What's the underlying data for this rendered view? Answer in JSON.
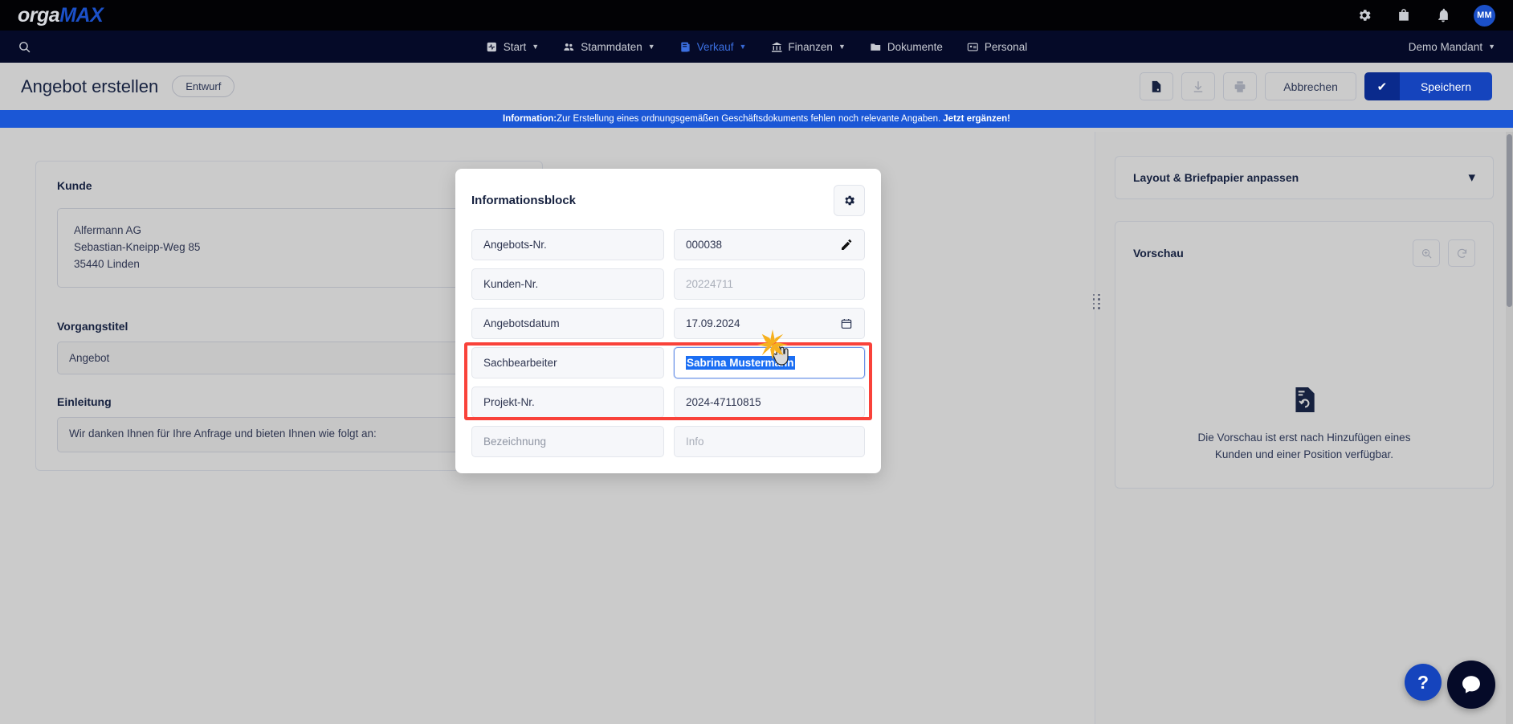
{
  "app": {
    "logo_orga": "orga",
    "logo_max": "MAX"
  },
  "topbar": {
    "icons": [
      "gear-icon",
      "shopping-bag-icon",
      "bell-icon"
    ],
    "avatar_initials": "MM"
  },
  "nav": {
    "search_icon": "search-icon",
    "items": [
      {
        "label": "Start",
        "icon": "activity-icon",
        "has_caret": true,
        "active": false
      },
      {
        "label": "Stammdaten",
        "icon": "people-icon",
        "has_caret": true,
        "active": false
      },
      {
        "label": "Verkauf",
        "icon": "document-icon",
        "has_caret": true,
        "active": true
      },
      {
        "label": "Finanzen",
        "icon": "bank-icon",
        "has_caret": true,
        "active": false
      },
      {
        "label": "Dokumente",
        "icon": "folder-icon",
        "has_caret": false,
        "active": false
      },
      {
        "label": "Personal",
        "icon": "id-card-icon",
        "has_caret": false,
        "active": false
      }
    ],
    "tenant": "Demo Mandant"
  },
  "header": {
    "title": "Angebot erstellen",
    "status_badge": "Entwurf",
    "actions": {
      "preview_doc_icon": "document-preview-icon",
      "download_icon": "download-icon",
      "print_icon": "print-icon",
      "cancel_label": "Abbrechen",
      "save_label": "Speichern",
      "save_check": "✔"
    }
  },
  "banner": {
    "prefix": "Information:",
    "message": " Zur Erstellung eines ordnungsgemäßen Geschäftsdokuments fehlen noch relevante Angaben.",
    "link": "Jetzt ergänzen!"
  },
  "left": {
    "kunde_label": "Kunde",
    "kunde_address": [
      "Alfermann AG",
      "Sebastian-Kneipp-Weg 85",
      "35440 Linden"
    ],
    "vorgangstitel_label": "Vorgangstitel",
    "vorgangstitel_value": "Angebot",
    "einleitung_label": "Einleitung",
    "einleitung_value": "Wir danken Ihnen für Ihre Anfrage und bieten Ihnen wie folgt an:",
    "einleitung_gear_icon": "gear-icon"
  },
  "info_card": {
    "title": "Informationsblock",
    "gear_icon": "gear-icon",
    "rows": [
      {
        "key": "Angebots-Nr.",
        "value": "000038",
        "muted_key": false,
        "muted_value": false,
        "trailing": "pencil-icon",
        "focused": false
      },
      {
        "key": "Kunden-Nr.",
        "value": "20224711",
        "muted_key": false,
        "muted_value": true,
        "trailing": "",
        "focused": false
      },
      {
        "key": "Angebotsdatum",
        "value": "17.09.2024",
        "muted_key": false,
        "muted_value": false,
        "trailing": "calendar-icon",
        "focused": false
      },
      {
        "key": "Sachbearbeiter",
        "value": "Sabrina Mustermann",
        "muted_key": false,
        "muted_value": false,
        "trailing": "",
        "focused": true
      },
      {
        "key": "Projekt-Nr.",
        "value": "2024-47110815",
        "muted_key": false,
        "muted_value": false,
        "trailing": "",
        "focused": false
      },
      {
        "key": "Bezeichnung",
        "value": "Info",
        "muted_key": true,
        "muted_value": true,
        "trailing": "",
        "focused": false
      }
    ],
    "highlight_color": "#f9423a",
    "selection_color": "#1b6ef3"
  },
  "right": {
    "layout_panel_title": "Layout & Briefpapier anpassen",
    "layout_chevron": "chevron-down-icon",
    "preview_title": "Vorschau",
    "preview_zoom_icon": "zoom-in-icon",
    "preview_refresh_icon": "refresh-icon",
    "empty_icon": "document-refresh-icon",
    "empty_text_line1": "Die Vorschau ist erst nach Hinzufügen eines",
    "empty_text_line2": "Kunden und einer Position verfügbar."
  },
  "fab": {
    "help_label": "?",
    "chat_icon": "chat-icon"
  },
  "colors": {
    "brand_blue": "#1544bd",
    "nav_dark": "#050a28",
    "topbar_black": "#020205",
    "page_bg": "#cbcbcb",
    "banner_blue": "#1b57d6",
    "highlight_red": "#f9423a",
    "selection_blue": "#1b6ef3"
  }
}
